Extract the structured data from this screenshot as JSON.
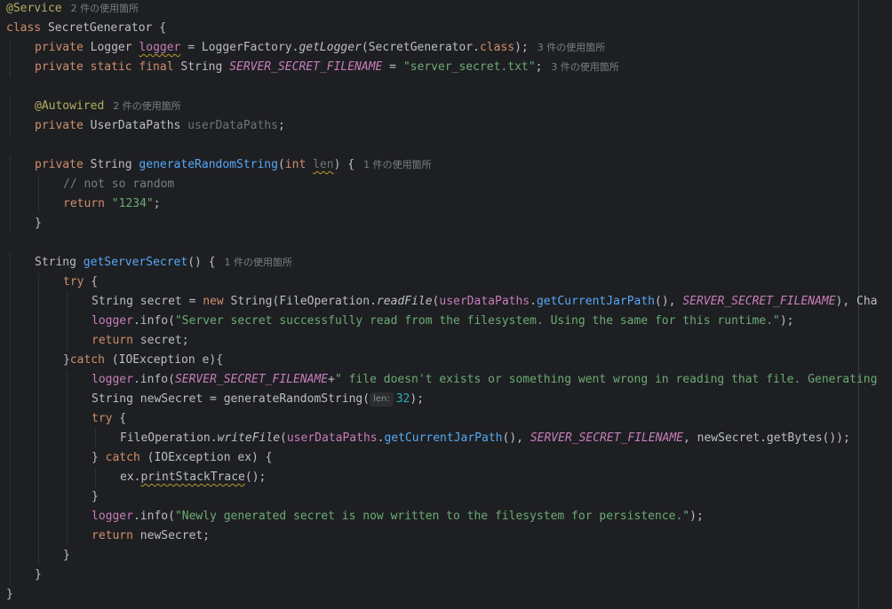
{
  "editor": {
    "lines": [
      {
        "indent": 0,
        "tokens": [
          {
            "t": "@Service",
            "c": "ann"
          }
        ],
        "usage": "2 件の使用箇所"
      },
      {
        "indent": 0,
        "tokens": [
          {
            "t": "class ",
            "c": "kw"
          },
          {
            "t": "SecretGenerator {",
            "c": "default"
          }
        ]
      },
      {
        "indent": 1,
        "tokens": [
          {
            "t": "private ",
            "c": "kw"
          },
          {
            "t": "Logger ",
            "c": "default"
          },
          {
            "t": "logger",
            "c": "field warn"
          },
          {
            "t": " = LoggerFactory.",
            "c": "default"
          },
          {
            "t": "getLogger",
            "c": "static-call"
          },
          {
            "t": "(SecretGenerator.",
            "c": "default"
          },
          {
            "t": "class",
            "c": "kw"
          },
          {
            "t": ");",
            "c": "default"
          }
        ],
        "usage": "3 件の使用箇所"
      },
      {
        "indent": 1,
        "tokens": [
          {
            "t": "private static final ",
            "c": "kw"
          },
          {
            "t": "String ",
            "c": "default"
          },
          {
            "t": "SERVER_SECRET_FILENAME",
            "c": "static-field"
          },
          {
            "t": " = ",
            "c": "default"
          },
          {
            "t": "\"server_secret.txt\"",
            "c": "str"
          },
          {
            "t": ";",
            "c": "default"
          }
        ],
        "usage": "3 件の使用箇所"
      },
      {
        "indent": 0,
        "tokens": []
      },
      {
        "indent": 1,
        "tokens": [
          {
            "t": "@Autowired",
            "c": "ann"
          }
        ],
        "usage": "2 件の使用箇所"
      },
      {
        "indent": 1,
        "tokens": [
          {
            "t": "private ",
            "c": "kw"
          },
          {
            "t": "UserDataPaths ",
            "c": "default"
          },
          {
            "t": "userDataPaths",
            "c": "param-unused"
          },
          {
            "t": ";",
            "c": "default"
          }
        ]
      },
      {
        "indent": 0,
        "tokens": []
      },
      {
        "indent": 1,
        "tokens": [
          {
            "t": "private ",
            "c": "kw"
          },
          {
            "t": "String ",
            "c": "default"
          },
          {
            "t": "generateRandomString",
            "c": "fn"
          },
          {
            "t": "(",
            "c": "default"
          },
          {
            "t": "int ",
            "c": "kw"
          },
          {
            "t": "len",
            "c": "param-unused warn"
          },
          {
            "t": ") {",
            "c": "default"
          }
        ],
        "usage": "1 件の使用箇所"
      },
      {
        "indent": 2,
        "tokens": [
          {
            "t": "// not so random",
            "c": "comment"
          }
        ]
      },
      {
        "indent": 2,
        "tokens": [
          {
            "t": "return ",
            "c": "kw"
          },
          {
            "t": "\"1234\"",
            "c": "str"
          },
          {
            "t": ";",
            "c": "default"
          }
        ]
      },
      {
        "indent": 1,
        "tokens": [
          {
            "t": "}",
            "c": "default"
          }
        ]
      },
      {
        "indent": 0,
        "tokens": []
      },
      {
        "indent": 1,
        "tokens": [
          {
            "t": "String ",
            "c": "default"
          },
          {
            "t": "getServerSecret",
            "c": "fn"
          },
          {
            "t": "() {",
            "c": "default"
          }
        ],
        "usage": "1 件の使用箇所"
      },
      {
        "indent": 2,
        "tokens": [
          {
            "t": "try",
            "c": "kw"
          },
          {
            "t": " {",
            "c": "default"
          }
        ]
      },
      {
        "indent": 3,
        "tokens": [
          {
            "t": "String secret = ",
            "c": "default"
          },
          {
            "t": "new ",
            "c": "kw"
          },
          {
            "t": "String(FileOperation.",
            "c": "default"
          },
          {
            "t": "readFile",
            "c": "static-call"
          },
          {
            "t": "(",
            "c": "default"
          },
          {
            "t": "userDataPaths",
            "c": "field"
          },
          {
            "t": ".",
            "c": "default"
          },
          {
            "t": "getCurrentJarPath",
            "c": "fn"
          },
          {
            "t": "(), ",
            "c": "default"
          },
          {
            "t": "SERVER_SECRET_FILENAME",
            "c": "static-field"
          },
          {
            "t": "), Cha",
            "c": "default"
          }
        ]
      },
      {
        "indent": 3,
        "tokens": [
          {
            "t": "logger",
            "c": "field"
          },
          {
            "t": ".info(",
            "c": "default"
          },
          {
            "t": "\"Server secret successfully read from the filesystem. Using the same for this runtime.\"",
            "c": "str"
          },
          {
            "t": ");",
            "c": "default"
          }
        ]
      },
      {
        "indent": 3,
        "tokens": [
          {
            "t": "return ",
            "c": "kw"
          },
          {
            "t": "secret;",
            "c": "default"
          }
        ]
      },
      {
        "indent": 2,
        "tokens": [
          {
            "t": "}",
            "c": "default"
          },
          {
            "t": "catch",
            "c": "kw"
          },
          {
            "t": " (IOException e){",
            "c": "default"
          }
        ]
      },
      {
        "indent": 3,
        "tokens": [
          {
            "t": "logger",
            "c": "field"
          },
          {
            "t": ".info(",
            "c": "default"
          },
          {
            "t": "SERVER_SECRET_FILENAME",
            "c": "static-field"
          },
          {
            "t": "+",
            "c": "default"
          },
          {
            "t": "\" file doesn't exists or something went wrong in reading that file. Generating",
            "c": "str"
          }
        ]
      },
      {
        "indent": 3,
        "tokens": [
          {
            "t": "String newSecret = generateRandomString(",
            "c": "default"
          },
          {
            "t": "len:",
            "c": "param-hint"
          },
          {
            "t": "32",
            "c": "num"
          },
          {
            "t": ");",
            "c": "default"
          }
        ]
      },
      {
        "indent": 3,
        "tokens": [
          {
            "t": "try",
            "c": "kw"
          },
          {
            "t": " {",
            "c": "default"
          }
        ]
      },
      {
        "indent": 4,
        "tokens": [
          {
            "t": "FileOperation.",
            "c": "default"
          },
          {
            "t": "writeFile",
            "c": "static-call"
          },
          {
            "t": "(",
            "c": "default"
          },
          {
            "t": "userDataPaths",
            "c": "field"
          },
          {
            "t": ".",
            "c": "default"
          },
          {
            "t": "getCurrentJarPath",
            "c": "fn"
          },
          {
            "t": "(), ",
            "c": "default"
          },
          {
            "t": "SERVER_SECRET_FILENAME",
            "c": "static-field"
          },
          {
            "t": ", newSecret.getBytes());",
            "c": "default"
          }
        ]
      },
      {
        "indent": 3,
        "tokens": [
          {
            "t": "} ",
            "c": "default"
          },
          {
            "t": "catch",
            "c": "kw"
          },
          {
            "t": " (IOException ex) {",
            "c": "default"
          }
        ]
      },
      {
        "indent": 4,
        "tokens": [
          {
            "t": "ex.",
            "c": "default"
          },
          {
            "t": "printStackTrace",
            "c": "default warn"
          },
          {
            "t": "();",
            "c": "default"
          }
        ]
      },
      {
        "indent": 3,
        "tokens": [
          {
            "t": "}",
            "c": "default"
          }
        ]
      },
      {
        "indent": 3,
        "tokens": [
          {
            "t": "logger",
            "c": "field"
          },
          {
            "t": ".info(",
            "c": "default"
          },
          {
            "t": "\"Newly generated secret is now written to the filesystem for persistence.\"",
            "c": "str"
          },
          {
            "t": ");",
            "c": "default"
          }
        ]
      },
      {
        "indent": 3,
        "tokens": [
          {
            "t": "return ",
            "c": "kw"
          },
          {
            "t": "newSecret;",
            "c": "default"
          }
        ]
      },
      {
        "indent": 2,
        "tokens": [
          {
            "t": "}",
            "c": "default"
          }
        ]
      },
      {
        "indent": 1,
        "tokens": [
          {
            "t": "}",
            "c": "default"
          }
        ]
      },
      {
        "indent": 0,
        "tokens": [
          {
            "t": "}",
            "c": "default"
          }
        ]
      }
    ]
  }
}
